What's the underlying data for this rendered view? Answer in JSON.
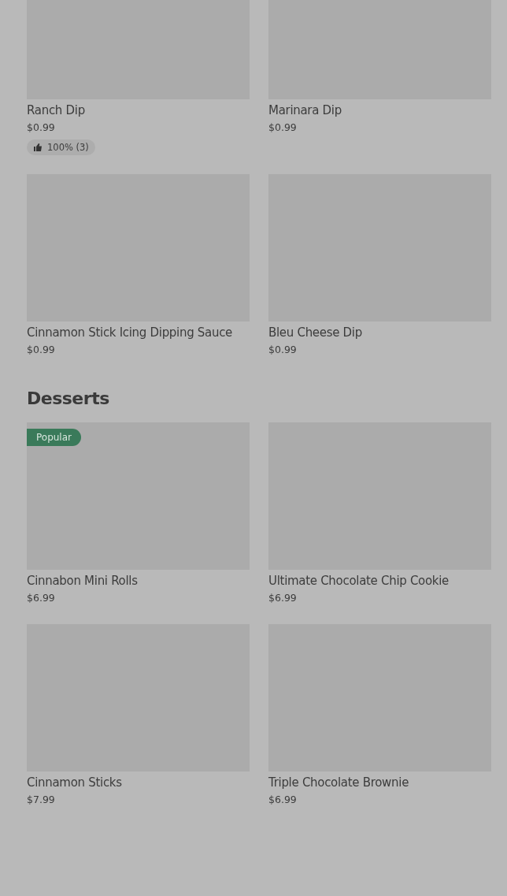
{
  "sections": [
    {
      "items": [
        {
          "name": "Ranch Dip",
          "price": "$0.99",
          "rating": "100% (3)"
        },
        {
          "name": "Marinara Dip",
          "price": "$0.99"
        },
        {
          "name": "Cinnamon Stick Icing Dipping Sauce",
          "price": "$0.99"
        },
        {
          "name": "Bleu Cheese Dip",
          "price": "$0.99"
        }
      ]
    },
    {
      "title": "Desserts",
      "items": [
        {
          "name": "Cinnabon Mini Rolls",
          "price": "$6.99",
          "badge": "Popular"
        },
        {
          "name": "Ultimate Chocolate Chip Cookie",
          "price": "$6.99"
        },
        {
          "name": "Cinnamon Sticks",
          "price": "$7.99"
        },
        {
          "name": "Triple Chocolate Brownie",
          "price": "$6.99"
        }
      ]
    }
  ]
}
